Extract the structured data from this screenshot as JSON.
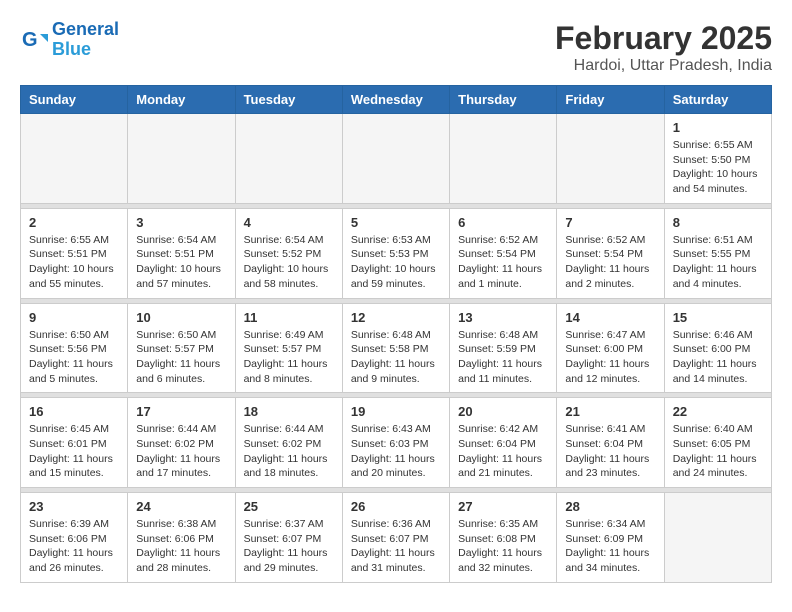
{
  "logo": {
    "line1": "General",
    "line2": "Blue"
  },
  "title": "February 2025",
  "subtitle": "Hardoi, Uttar Pradesh, India",
  "headers": [
    "Sunday",
    "Monday",
    "Tuesday",
    "Wednesday",
    "Thursday",
    "Friday",
    "Saturday"
  ],
  "weeks": [
    [
      {
        "day": "",
        "info": ""
      },
      {
        "day": "",
        "info": ""
      },
      {
        "day": "",
        "info": ""
      },
      {
        "day": "",
        "info": ""
      },
      {
        "day": "",
        "info": ""
      },
      {
        "day": "",
        "info": ""
      },
      {
        "day": "1",
        "info": "Sunrise: 6:55 AM\nSunset: 5:50 PM\nDaylight: 10 hours\nand 54 minutes."
      }
    ],
    [
      {
        "day": "2",
        "info": "Sunrise: 6:55 AM\nSunset: 5:51 PM\nDaylight: 10 hours\nand 55 minutes."
      },
      {
        "day": "3",
        "info": "Sunrise: 6:54 AM\nSunset: 5:51 PM\nDaylight: 10 hours\nand 57 minutes."
      },
      {
        "day": "4",
        "info": "Sunrise: 6:54 AM\nSunset: 5:52 PM\nDaylight: 10 hours\nand 58 minutes."
      },
      {
        "day": "5",
        "info": "Sunrise: 6:53 AM\nSunset: 5:53 PM\nDaylight: 10 hours\nand 59 minutes."
      },
      {
        "day": "6",
        "info": "Sunrise: 6:52 AM\nSunset: 5:54 PM\nDaylight: 11 hours\nand 1 minute."
      },
      {
        "day": "7",
        "info": "Sunrise: 6:52 AM\nSunset: 5:54 PM\nDaylight: 11 hours\nand 2 minutes."
      },
      {
        "day": "8",
        "info": "Sunrise: 6:51 AM\nSunset: 5:55 PM\nDaylight: 11 hours\nand 4 minutes."
      }
    ],
    [
      {
        "day": "9",
        "info": "Sunrise: 6:50 AM\nSunset: 5:56 PM\nDaylight: 11 hours\nand 5 minutes."
      },
      {
        "day": "10",
        "info": "Sunrise: 6:50 AM\nSunset: 5:57 PM\nDaylight: 11 hours\nand 6 minutes."
      },
      {
        "day": "11",
        "info": "Sunrise: 6:49 AM\nSunset: 5:57 PM\nDaylight: 11 hours\nand 8 minutes."
      },
      {
        "day": "12",
        "info": "Sunrise: 6:48 AM\nSunset: 5:58 PM\nDaylight: 11 hours\nand 9 minutes."
      },
      {
        "day": "13",
        "info": "Sunrise: 6:48 AM\nSunset: 5:59 PM\nDaylight: 11 hours\nand 11 minutes."
      },
      {
        "day": "14",
        "info": "Sunrise: 6:47 AM\nSunset: 6:00 PM\nDaylight: 11 hours\nand 12 minutes."
      },
      {
        "day": "15",
        "info": "Sunrise: 6:46 AM\nSunset: 6:00 PM\nDaylight: 11 hours\nand 14 minutes."
      }
    ],
    [
      {
        "day": "16",
        "info": "Sunrise: 6:45 AM\nSunset: 6:01 PM\nDaylight: 11 hours\nand 15 minutes."
      },
      {
        "day": "17",
        "info": "Sunrise: 6:44 AM\nSunset: 6:02 PM\nDaylight: 11 hours\nand 17 minutes."
      },
      {
        "day": "18",
        "info": "Sunrise: 6:44 AM\nSunset: 6:02 PM\nDaylight: 11 hours\nand 18 minutes."
      },
      {
        "day": "19",
        "info": "Sunrise: 6:43 AM\nSunset: 6:03 PM\nDaylight: 11 hours\nand 20 minutes."
      },
      {
        "day": "20",
        "info": "Sunrise: 6:42 AM\nSunset: 6:04 PM\nDaylight: 11 hours\nand 21 minutes."
      },
      {
        "day": "21",
        "info": "Sunrise: 6:41 AM\nSunset: 6:04 PM\nDaylight: 11 hours\nand 23 minutes."
      },
      {
        "day": "22",
        "info": "Sunrise: 6:40 AM\nSunset: 6:05 PM\nDaylight: 11 hours\nand 24 minutes."
      }
    ],
    [
      {
        "day": "23",
        "info": "Sunrise: 6:39 AM\nSunset: 6:06 PM\nDaylight: 11 hours\nand 26 minutes."
      },
      {
        "day": "24",
        "info": "Sunrise: 6:38 AM\nSunset: 6:06 PM\nDaylight: 11 hours\nand 28 minutes."
      },
      {
        "day": "25",
        "info": "Sunrise: 6:37 AM\nSunset: 6:07 PM\nDaylight: 11 hours\nand 29 minutes."
      },
      {
        "day": "26",
        "info": "Sunrise: 6:36 AM\nSunset: 6:07 PM\nDaylight: 11 hours\nand 31 minutes."
      },
      {
        "day": "27",
        "info": "Sunrise: 6:35 AM\nSunset: 6:08 PM\nDaylight: 11 hours\nand 32 minutes."
      },
      {
        "day": "28",
        "info": "Sunrise: 6:34 AM\nSunset: 6:09 PM\nDaylight: 11 hours\nand 34 minutes."
      },
      {
        "day": "",
        "info": ""
      }
    ]
  ]
}
